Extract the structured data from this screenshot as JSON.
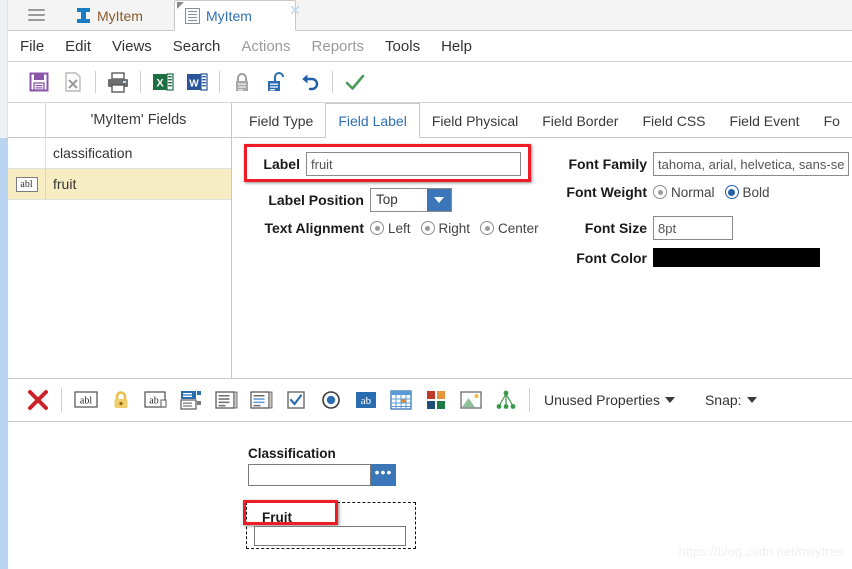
{
  "window": {
    "hamburger_icon": "hamburger-menu-icon",
    "tabs": [
      {
        "label": "MyItem",
        "icon": "myitem-blue-icon",
        "active": false,
        "closable": false
      },
      {
        "label": "MyItem",
        "icon": "document-icon",
        "active": true,
        "closable": true,
        "close_icon": "close-icon"
      }
    ]
  },
  "menubar": {
    "items": [
      {
        "label": "File",
        "disabled": false
      },
      {
        "label": "Edit",
        "disabled": false
      },
      {
        "label": "Views",
        "disabled": false
      },
      {
        "label": "Search",
        "disabled": false
      },
      {
        "label": "Actions",
        "disabled": true
      },
      {
        "label": "Reports",
        "disabled": true
      },
      {
        "label": "Tools",
        "disabled": false
      },
      {
        "label": "Help",
        "disabled": false
      }
    ]
  },
  "toolbar": {
    "buttons": [
      {
        "name": "save-icon",
        "title": "Save"
      },
      {
        "name": "delete-document-icon",
        "title": "Delete"
      },
      {
        "name": "print-icon",
        "title": "Print"
      },
      {
        "name": "export-excel-icon",
        "title": "Export to Excel"
      },
      {
        "name": "export-word-icon",
        "title": "Export to Word"
      },
      {
        "name": "lock-icon",
        "title": "Lock"
      },
      {
        "name": "unlock-icon",
        "title": "Unlock"
      },
      {
        "name": "undo-icon",
        "title": "Undo"
      },
      {
        "name": "checkmark-icon",
        "title": "Apply"
      }
    ]
  },
  "fields_panel": {
    "column_blank": "",
    "column_header": "'MyItem' Fields",
    "rows": [
      {
        "icon": "",
        "name": "classification",
        "selected": false
      },
      {
        "icon": "abl-textfield-icon",
        "name": "fruit",
        "selected": true
      }
    ]
  },
  "property_tabs": {
    "items": [
      {
        "label": "Field Type",
        "active": false
      },
      {
        "label": "Field Label",
        "active": true
      },
      {
        "label": "Field Physical",
        "active": false
      },
      {
        "label": "Field Border",
        "active": false
      },
      {
        "label": "Field CSS",
        "active": false
      },
      {
        "label": "Field Event",
        "active": false
      },
      {
        "label": "Fo",
        "active": false
      }
    ]
  },
  "field_label_form": {
    "label_caption": "Label",
    "label_value": "fruit",
    "label_placeholder": "",
    "label_position_caption": "Label Position",
    "label_position_value": "Top",
    "text_alignment_caption": "Text Alignment",
    "alignment_options": [
      {
        "label": "Left",
        "selected": false
      },
      {
        "label": "Right",
        "selected": false
      },
      {
        "label": "Center",
        "selected": false
      }
    ],
    "font_family_caption": "Font Family",
    "font_family_value": "tahoma, arial, helvetica, sans-serif",
    "font_weight_caption": "Font Weight",
    "font_weight_options": [
      {
        "label": "Normal",
        "selected": false
      },
      {
        "label": "Bold",
        "selected": true
      }
    ],
    "font_size_caption": "Font Size",
    "font_size_value": "8pt",
    "font_color_caption": "Font Color",
    "font_color_value": "#000000"
  },
  "widget_toolbar": {
    "buttons": [
      {
        "name": "delete-x-icon",
        "title": "Delete"
      },
      {
        "name": "abl-textfield-icon",
        "title": "Text Field"
      },
      {
        "name": "lock-yellow-icon",
        "title": "Lock"
      },
      {
        "name": "abl-lookup-icon",
        "title": "Lookup Field"
      },
      {
        "name": "combo-field-icon",
        "title": "Combo Box"
      },
      {
        "name": "list-field-icon",
        "title": "List Box"
      },
      {
        "name": "multiline-field-icon",
        "title": "Text Area"
      },
      {
        "name": "checkbox-icon",
        "title": "Checkbox"
      },
      {
        "name": "radio-button-icon",
        "title": "Radio Button"
      },
      {
        "name": "ab-label-icon",
        "title": "Label"
      },
      {
        "name": "grid-table-icon",
        "title": "Grid"
      },
      {
        "name": "color-blocks-icon",
        "title": "Panel"
      },
      {
        "name": "image-icon",
        "title": "Image"
      },
      {
        "name": "tree-node-icon",
        "title": "Tree"
      }
    ],
    "unused_properties_label": "Unused Properties",
    "unused_properties_caret": "chevron-down-icon",
    "snap_label": "Snap:",
    "snap_caret": "chevron-down-icon"
  },
  "design_canvas": {
    "classification_label": "Classification",
    "classification_value": "",
    "classification_lookup_icon": "ellipsis-icon",
    "fruit_label": "Fruit",
    "fruit_value": ""
  },
  "watermark": "https://blog.csdn.net/hwytree",
  "colors": {
    "accent_blue": "#2f6fb5",
    "highlight_red": "#ee1c25",
    "selected_row": "#f7edc2",
    "button_blue": "#3a76b8",
    "rail_blue": "#b8d4f0"
  }
}
